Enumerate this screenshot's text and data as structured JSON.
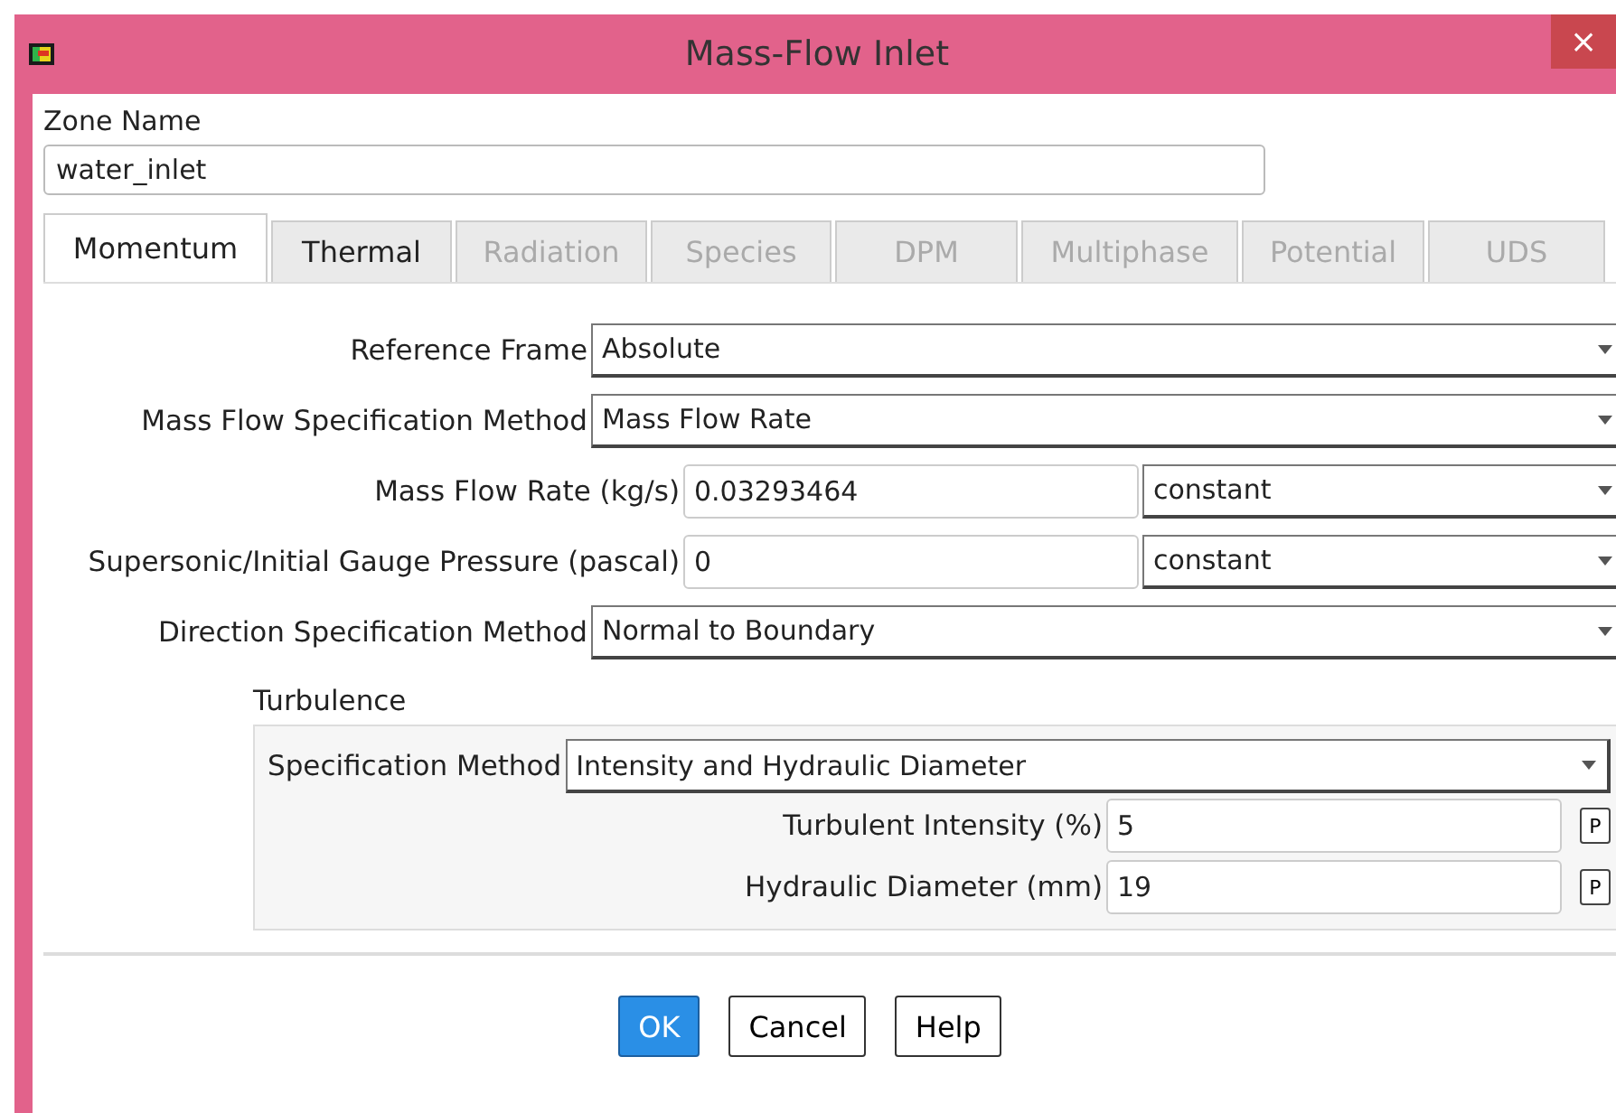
{
  "window": {
    "title": "Mass-Flow Inlet",
    "close": "×"
  },
  "zone": {
    "label": "Zone Name",
    "value": "water_inlet"
  },
  "tabs": [
    {
      "label": "Momentum",
      "selected": true,
      "disabled": false
    },
    {
      "label": "Thermal",
      "selected": false,
      "disabled": false
    },
    {
      "label": "Radiation",
      "selected": false,
      "disabled": true
    },
    {
      "label": "Species",
      "selected": false,
      "disabled": true
    },
    {
      "label": "DPM",
      "selected": false,
      "disabled": true
    },
    {
      "label": "Multiphase",
      "selected": false,
      "disabled": true
    },
    {
      "label": "Potential",
      "selected": false,
      "disabled": true
    },
    {
      "label": "UDS",
      "selected": false,
      "disabled": true
    }
  ],
  "fields": [
    {
      "kind": "select",
      "label": "Reference Frame",
      "value": "Absolute"
    },
    {
      "kind": "select",
      "label": "Mass Flow Specification Method",
      "value": "Mass Flow Rate"
    },
    {
      "kind": "profile",
      "label": "Mass Flow Rate (kg/s)",
      "value": "0.03293464",
      "profile": "constant"
    },
    {
      "kind": "profile",
      "label": "Supersonic/Initial Gauge Pressure (pascal)",
      "value": "0",
      "profile": "constant"
    },
    {
      "kind": "select",
      "label": "Direction Specification Method",
      "value": "Normal to Boundary"
    }
  ],
  "turbulence": {
    "title": "Turbulence",
    "method_label": "Specification Method",
    "method": "Intensity and Hydraulic Diameter",
    "fields": [
      {
        "label": "Turbulent Intensity (%)",
        "value": "5",
        "param": "P"
      },
      {
        "label": "Hydraulic Diameter (mm)",
        "value": "19",
        "param": "P"
      }
    ]
  },
  "buttons": [
    {
      "label": "OK",
      "selected": true
    },
    {
      "label": "Cancel",
      "selected": false
    },
    {
      "label": "Help",
      "selected": false
    }
  ]
}
